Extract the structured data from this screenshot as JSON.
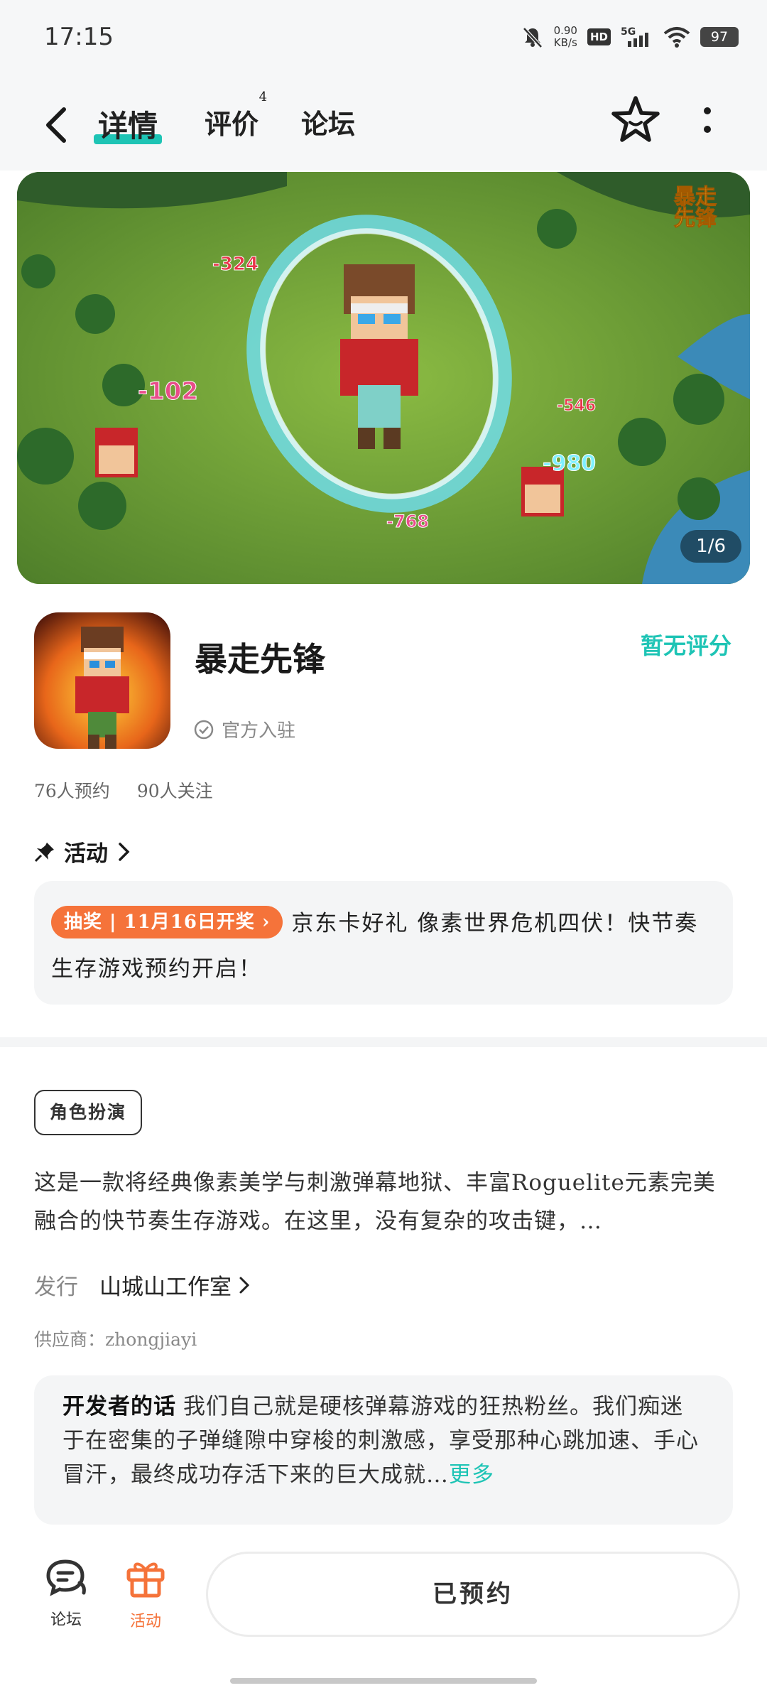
{
  "status_bar": {
    "time": "17:15",
    "speed_value": "0.90",
    "speed_unit": "KB/s",
    "hd": "HD",
    "network": "5G",
    "battery": "97"
  },
  "header": {
    "tabs": [
      {
        "label": "详情",
        "active": true
      },
      {
        "label": "评价",
        "badge": "4"
      },
      {
        "label": "论坛"
      }
    ],
    "icons": [
      "back-arrow-icon",
      "favorite-star-icon",
      "more-vertical-icon"
    ]
  },
  "banner": {
    "counter": "1/6",
    "logo_text": "暴走先锋",
    "damage_numbers": [
      "-324",
      "-102",
      "-546",
      "-980",
      "-768"
    ]
  },
  "game": {
    "title": "暴走先锋",
    "rating": "暂无评分",
    "verified": "官方入驻",
    "reservations": "76人预约",
    "followers": "90人关注"
  },
  "activity": {
    "heading": "活动",
    "tag": "抽奖 | 11月16日开奖",
    "text": "京东卡好礼 像素世界危机四伏！快节奏生存游戏预约开启！"
  },
  "details": {
    "genre": "角色扮演",
    "description": "这是一款将经典像素美学与刺激弹幕地狱、丰富Roguelite元素完美融合的快节奏生存游戏。在这里，没有复杂的攻击键，…",
    "publisher_label": "发行",
    "publisher": "山城山工作室",
    "supplier": "供应商：zhongjiayi"
  },
  "developer": {
    "label": "开发者的话",
    "text": "我们自己就是硬核弹幕游戏的狂热粉丝。我们痴迷于在密集的子弹缝隙中穿梭的刺激感，享受那种心跳加速、手心冒汗，最终成功存活下来的巨大成就…",
    "more": "更多"
  },
  "bottom_bar": {
    "forum": "论坛",
    "activity": "活动",
    "reserve_button": "已预约"
  },
  "colors": {
    "accent": "#1ec4b5",
    "orange": "#f5733a"
  }
}
